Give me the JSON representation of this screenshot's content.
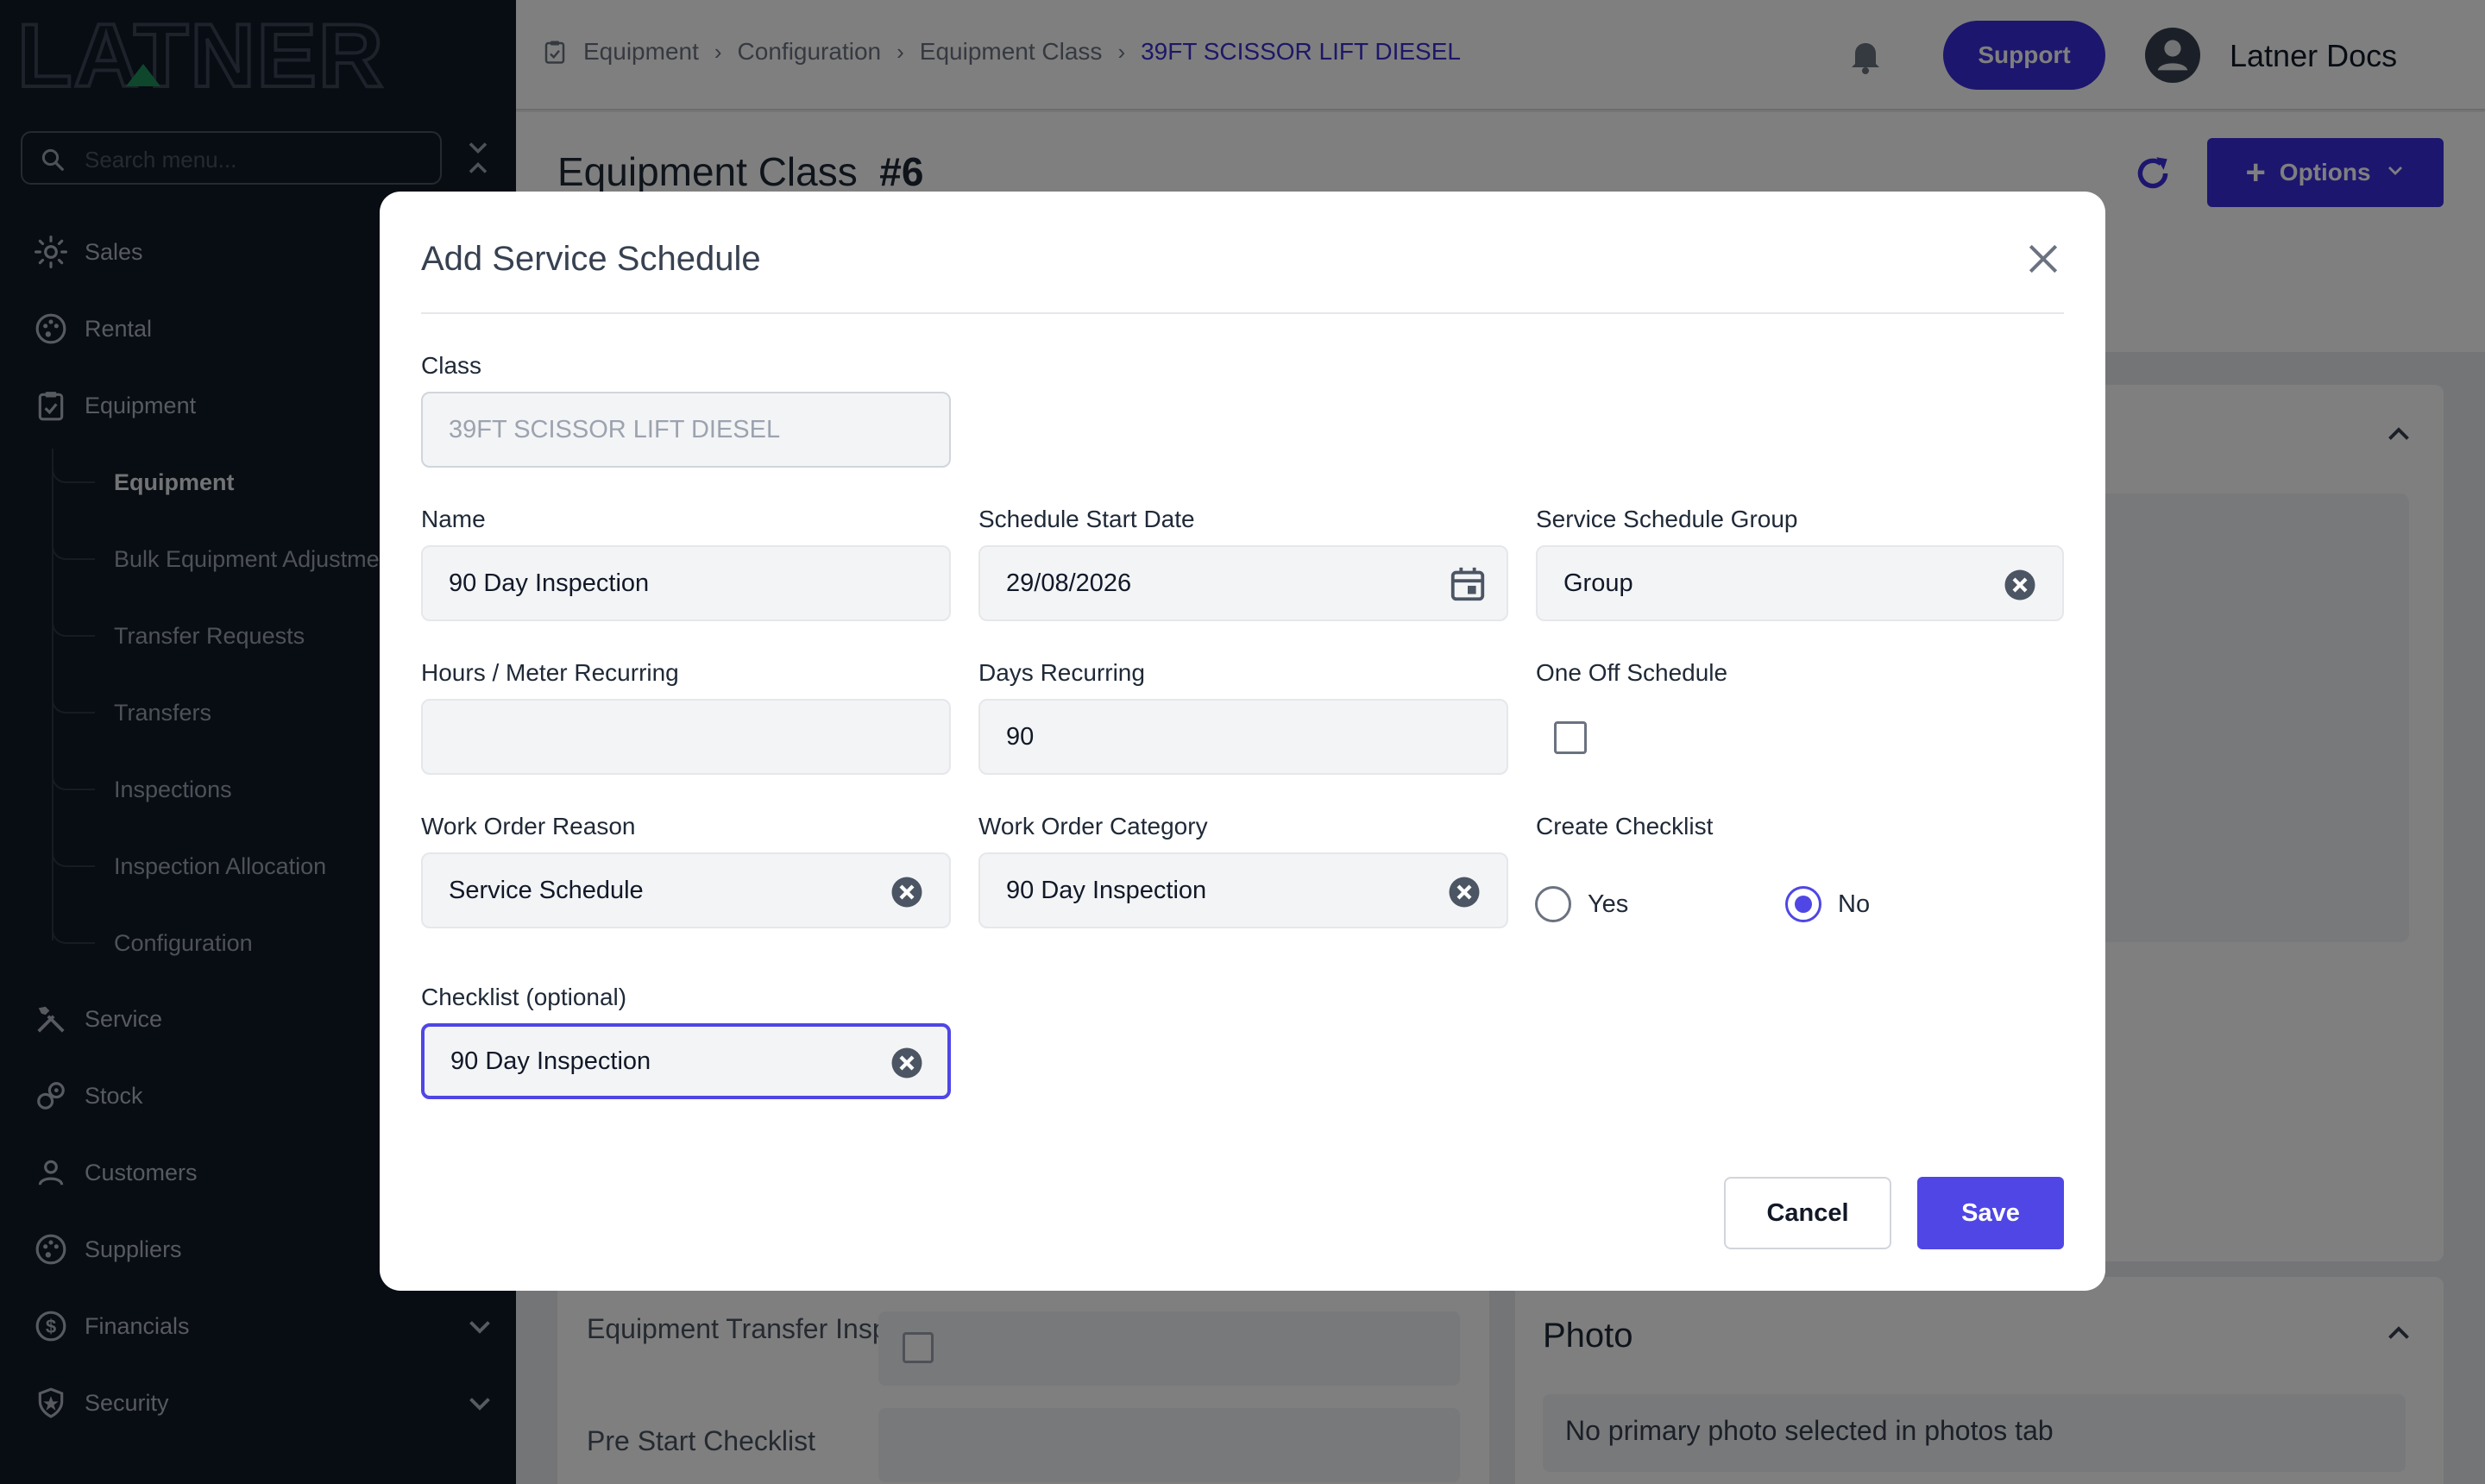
{
  "brand": {
    "logo_text": "LATNER"
  },
  "sidebar": {
    "search_placeholder": "Search menu...",
    "items": [
      {
        "label": "Sales"
      },
      {
        "label": "Rental"
      },
      {
        "label": "Equipment"
      },
      {
        "label": "Service"
      },
      {
        "label": "Stock"
      },
      {
        "label": "Customers"
      },
      {
        "label": "Suppliers"
      },
      {
        "label": "Financials"
      },
      {
        "label": "Security"
      }
    ],
    "equipment_sub": [
      {
        "label": "Equipment"
      },
      {
        "label": "Bulk Equipment Adjustment"
      },
      {
        "label": "Transfer Requests"
      },
      {
        "label": "Transfers"
      },
      {
        "label": "Inspections"
      },
      {
        "label": "Inspection Allocation"
      },
      {
        "label": "Configuration"
      }
    ]
  },
  "topbar": {
    "breadcrumbs": [
      "Equipment",
      "Configuration",
      "Equipment Class",
      "39FT SCISSOR LIFT DIESEL"
    ],
    "support_label": "Support",
    "user_name": "Latner Docs"
  },
  "page": {
    "title": "Equipment Class",
    "title_id": "#6",
    "options_label": "Options",
    "bg_labels": {
      "transfer_inspections": "Equipment Transfer Inspections",
      "pre_start": "Pre Start Checklist"
    },
    "photo": {
      "title": "Photo",
      "message": "No primary photo selected in photos tab"
    }
  },
  "modal": {
    "title": "Add Service Schedule",
    "class": {
      "label": "Class",
      "value": "39FT SCISSOR LIFT DIESEL"
    },
    "name": {
      "label": "Name",
      "value": "90 Day Inspection"
    },
    "start_date": {
      "label": "Schedule Start Date",
      "value": "29/08/2026"
    },
    "group": {
      "label": "Service Schedule Group",
      "value": "Group"
    },
    "hours": {
      "label": "Hours / Meter Recurring",
      "value": ""
    },
    "days": {
      "label": "Days Recurring",
      "value": "90"
    },
    "one_off": {
      "label": "One Off Schedule",
      "checked": false
    },
    "wo_reason": {
      "label": "Work Order Reason",
      "value": "Service Schedule"
    },
    "wo_category": {
      "label": "Work Order Category",
      "value": "90 Day Inspection"
    },
    "create_checklist": {
      "label": "Create Checklist",
      "yes": "Yes",
      "no": "No",
      "selected": "No"
    },
    "checklist": {
      "label": "Checklist (optional)",
      "value": "90 Day Inspection"
    },
    "cancel_label": "Cancel",
    "save_label": "Save"
  },
  "colors": {
    "accent": "#4f46e5",
    "sidebar_bg": "#111827",
    "brand_green": "#1f8f5a"
  },
  "icons": [
    "search-icon",
    "collapse-icon",
    "bell-icon",
    "refresh-icon",
    "plus-icon",
    "close-icon",
    "calendar-icon",
    "clear-icon"
  ]
}
